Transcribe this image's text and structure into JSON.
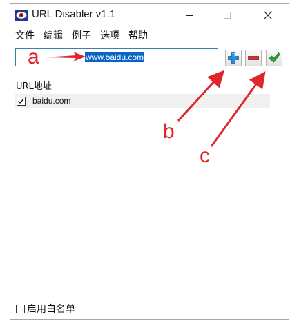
{
  "window": {
    "title": "URL Disabler v1.1",
    "controls": {
      "minimize": "minimize",
      "maximize": "maximize",
      "close": "close"
    }
  },
  "menu": {
    "items": [
      "文件",
      "编辑",
      "例子",
      "选项",
      "帮助"
    ]
  },
  "toolbar": {
    "url_value": "www.baidu.com",
    "add_icon": "plus-icon",
    "remove_icon": "minus-icon",
    "apply_icon": "checkmark-icon"
  },
  "list": {
    "header": "URL地址",
    "rows": [
      {
        "checked": true,
        "url": "baidu.com"
      }
    ]
  },
  "footer": {
    "whitelist_label": "启用白名单",
    "whitelist_checked": false
  },
  "annotations": {
    "labels": [
      "a",
      "b",
      "c"
    ],
    "color": "#e0252b"
  },
  "colors": {
    "accent": "#0a64c8",
    "input_border": "#3c7fb1",
    "add_button": "#2a8fd6",
    "remove_button": "#d6303a",
    "apply_button": "#2ea82e"
  }
}
